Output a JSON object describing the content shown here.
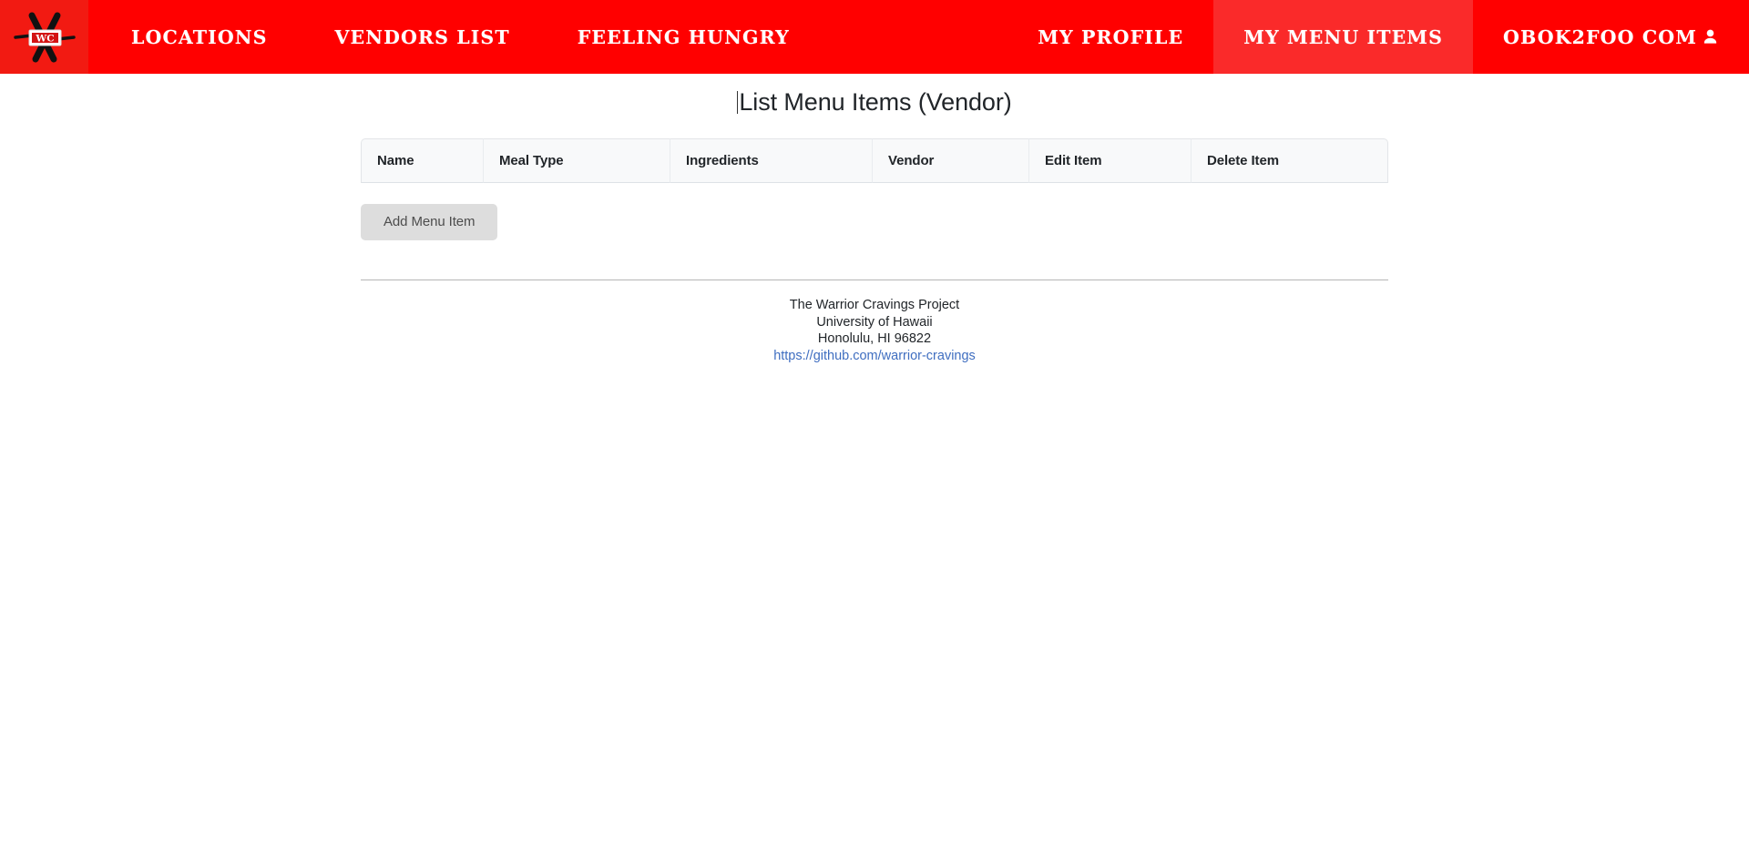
{
  "navbar": {
    "brand": {
      "icon": "warrior-cravings-logo",
      "badge_text": "WC",
      "background": "#f21a12"
    },
    "background": "#ff0000",
    "active_background": "#fa2a2a",
    "left_items": [
      {
        "label": "LOCATIONS",
        "name": "locations"
      },
      {
        "label": "VENDORS LIST",
        "name": "vendors-list"
      },
      {
        "label": "FEELING HUNGRY",
        "name": "feeling-hungry"
      }
    ],
    "right_items": [
      {
        "label": "MY PROFILE",
        "name": "my-profile",
        "active": false
      },
      {
        "label": "MY MENU ITEMS",
        "name": "my-menu-items",
        "active": true
      },
      {
        "label": "OBOK2FOO COM",
        "name": "user-account",
        "active": false,
        "icon": "user-icon"
      }
    ]
  },
  "main": {
    "page_title": "List Menu Items (Vendor)",
    "table": {
      "headers": [
        "Name",
        "Meal Type",
        "Ingredients",
        "Vendor",
        "Edit Item",
        "Delete Item"
      ],
      "rows": []
    },
    "add_button_label": "Add Menu Item"
  },
  "footer": {
    "line1": "The Warrior Cravings Project",
    "line2": "University of Hawaii",
    "line3": "Honolulu, HI 96822",
    "link_text": "https://github.com/warrior-cravings",
    "link_color": "#3f6ec0"
  }
}
